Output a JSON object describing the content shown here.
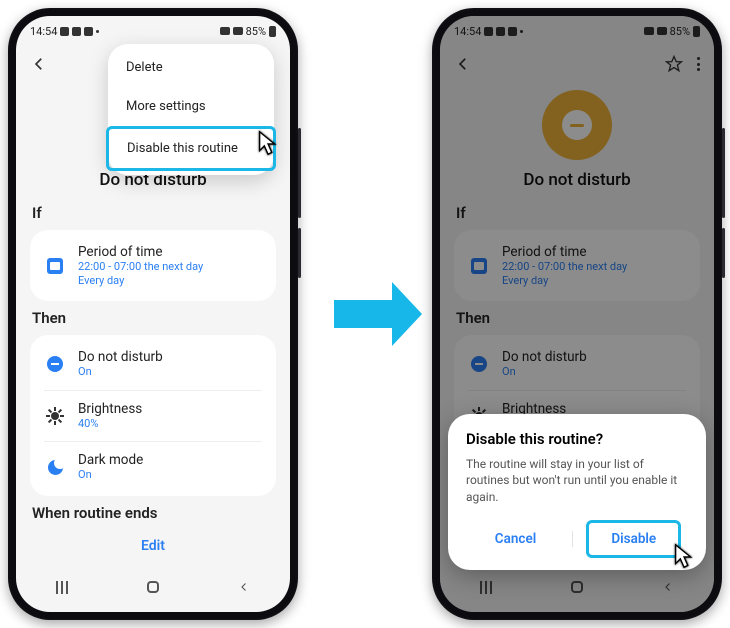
{
  "status": {
    "time": "14:54",
    "battery": "85%"
  },
  "page": {
    "title": "Do not disturb",
    "if_label": "If",
    "then_label": "Then",
    "ends_label": "When routine ends",
    "edit_label": "Edit"
  },
  "if_card": {
    "title": "Period of time",
    "time": "22:00 - 07:00 the next day",
    "repeat": "Every day"
  },
  "then_items": [
    {
      "title": "Do not disturb",
      "sub": "On"
    },
    {
      "title": "Brightness",
      "sub": "40%"
    },
    {
      "title": "Dark mode",
      "sub": "On"
    }
  ],
  "menu": {
    "delete": "Delete",
    "more": "More settings",
    "disable": "Disable this routine"
  },
  "dialog": {
    "title": "Disable this routine?",
    "body": "The routine will stay in your list of routines but won't run until you enable it again.",
    "cancel": "Cancel",
    "confirm": "Disable"
  }
}
